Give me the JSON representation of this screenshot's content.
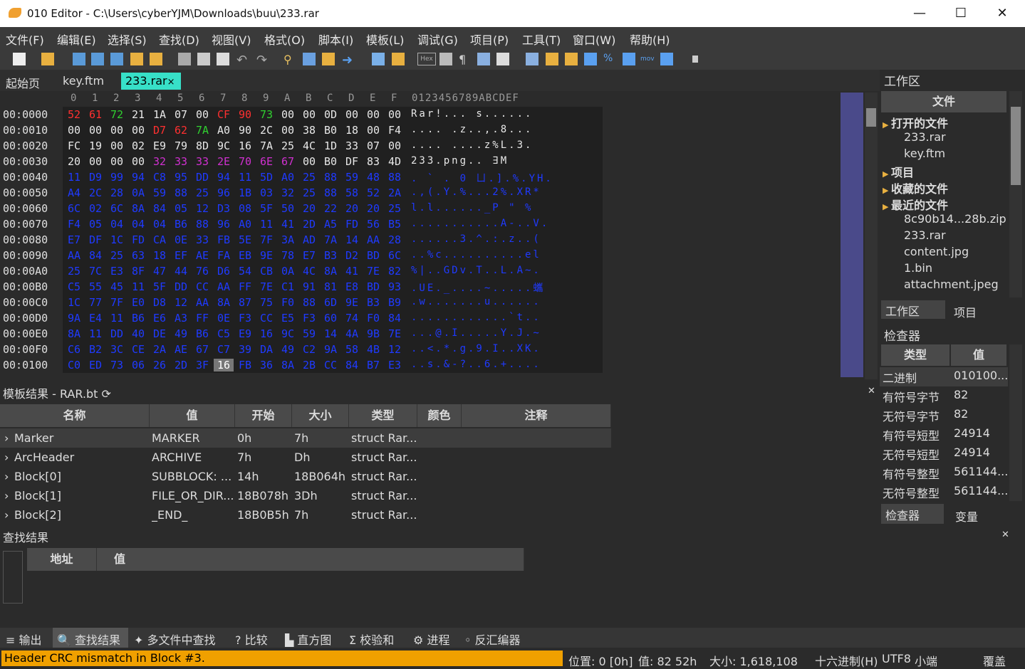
{
  "window": {
    "title": "010 Editor - C:\\Users\\cyberYJM\\Downloads\\buu\\233.rar",
    "min": "—",
    "max": "☐",
    "close": "✕"
  },
  "menu": [
    "文件(F)",
    "编辑(E)",
    "选择(S)",
    "查找(D)",
    "视图(V)",
    "格式(O)",
    "脚本(I)",
    "模板(L)",
    "调试(G)",
    "项目(P)",
    "工具(T)",
    "窗口(W)",
    "帮助(H)"
  ],
  "tabs": [
    "起始页",
    "key.ftm",
    "233.rar"
  ],
  "tab_close": "×",
  "hex": {
    "col_header": [
      "0",
      "1",
      "2",
      "3",
      "4",
      "5",
      "6",
      "7",
      "8",
      "9",
      "A",
      "B",
      "C",
      "D",
      "E",
      "F"
    ],
    "ascii_header": "0123456789ABCDEF",
    "rows": [
      {
        "addr": "00:0000",
        "bytes": [
          "52",
          "61",
          "72",
          "21",
          "1A",
          "07",
          "00",
          "CF",
          "90",
          "73",
          "00",
          "00",
          "0D",
          "00",
          "00",
          "00"
        ],
        "ascii": "Rar!...  s......"
      },
      {
        "addr": "00:0010",
        "bytes": [
          "00",
          "00",
          "00",
          "00",
          "D7",
          "62",
          "7A",
          "A0",
          "90",
          "2C",
          "00",
          "38",
          "B0",
          "18",
          "00",
          "F4"
        ],
        "ascii": "....  .z..,.8..."
      },
      {
        "addr": "00:0020",
        "bytes": [
          "FC",
          "19",
          "00",
          "02",
          "E9",
          "79",
          "8D",
          "9C",
          "16",
          "7A",
          "25",
          "4C",
          "1D",
          "33",
          "07",
          "00"
        ],
        "ascii": "....  ....z%L.3."
      },
      {
        "addr": "00:0030",
        "bytes": [
          "20",
          "00",
          "00",
          "00",
          "32",
          "33",
          "33",
          "2E",
          "70",
          "6E",
          "67",
          "00",
          "B0",
          "DF",
          "83",
          "4D"
        ],
        "ascii": "    233.png.. ∃M"
      },
      {
        "addr": "00:0040",
        "bytes": [
          "11",
          "D9",
          "99",
          "94",
          "C8",
          "95",
          "DD",
          "94",
          "11",
          "5D",
          "A0",
          "25",
          "88",
          "59",
          "48",
          "88"
        ],
        "ascii": ". ` . 0 ㄩ.].%.YH."
      },
      {
        "addr": "00:0050",
        "bytes": [
          "A4",
          "2C",
          "28",
          "0A",
          "59",
          "88",
          "25",
          "96",
          "1B",
          "03",
          "32",
          "25",
          "88",
          "58",
          "52",
          "2A"
        ],
        "ascii": ".,(.Y.%...2%.XR*"
      },
      {
        "addr": "00:0060",
        "bytes": [
          "6C",
          "02",
          "6C",
          "8A",
          "84",
          "05",
          "12",
          "D3",
          "08",
          "5F",
          "50",
          "20",
          "22",
          "20",
          "20",
          "25"
        ],
        "ascii": "l.l......_P \"  %"
      },
      {
        "addr": "00:0070",
        "bytes": [
          "F4",
          "05",
          "04",
          "04",
          "04",
          "B6",
          "88",
          "96",
          "A0",
          "11",
          "41",
          "2D",
          "A5",
          "FD",
          "56",
          "B5"
        ],
        "ascii": "...........A-..V."
      },
      {
        "addr": "00:0080",
        "bytes": [
          "E7",
          "DF",
          "1C",
          "FD",
          "CA",
          "0E",
          "33",
          "FB",
          "5E",
          "7F",
          "3A",
          "AD",
          "7A",
          "14",
          "AA",
          "28"
        ],
        "ascii": "......3.^.:.z..("
      },
      {
        "addr": "00:0090",
        "bytes": [
          "AA",
          "84",
          "25",
          "63",
          "18",
          "EF",
          "AE",
          "FA",
          "EB",
          "9E",
          "78",
          "E7",
          "B3",
          "D2",
          "BD",
          "6C"
        ],
        "ascii": "..%c..........el"
      },
      {
        "addr": "00:00A0",
        "bytes": [
          "25",
          "7C",
          "E3",
          "8F",
          "47",
          "44",
          "76",
          "D6",
          "54",
          "CB",
          "0A",
          "4C",
          "8A",
          "41",
          "7E",
          "82"
        ],
        "ascii": "%|..GDv.T..L.A~."
      },
      {
        "addr": "00:00B0",
        "bytes": [
          "C5",
          "55",
          "45",
          "11",
          "5F",
          "DD",
          "CC",
          "AA",
          "FF",
          "7E",
          "C1",
          "91",
          "81",
          "E8",
          "BD",
          "93"
        ],
        "ascii": ".UE._....~.....蠵"
      },
      {
        "addr": "00:00C0",
        "bytes": [
          "1C",
          "77",
          "7F",
          "E0",
          "D8",
          "12",
          "AA",
          "8A",
          "87",
          "75",
          "F0",
          "88",
          "6D",
          "9E",
          "B3",
          "B9"
        ],
        "ascii": ".w.......u......"
      },
      {
        "addr": "00:00D0",
        "bytes": [
          "9A",
          "E4",
          "11",
          "B6",
          "E6",
          "A3",
          "FF",
          "0E",
          "F3",
          "CC",
          "E5",
          "F3",
          "60",
          "74",
          "F0",
          "84"
        ],
        "ascii": "............`t.."
      },
      {
        "addr": "00:00E0",
        "bytes": [
          "8A",
          "11",
          "DD",
          "40",
          "DE",
          "49",
          "B6",
          "C5",
          "E9",
          "16",
          "9C",
          "59",
          "14",
          "4A",
          "9B",
          "7E"
        ],
        "ascii": "...@.I.....Y.J.~"
      },
      {
        "addr": "00:00F0",
        "bytes": [
          "C6",
          "B2",
          "3C",
          "CE",
          "2A",
          "AE",
          "67",
          "C7",
          "39",
          "DA",
          "49",
          "C2",
          "9A",
          "58",
          "4B",
          "12"
        ],
        "ascii": "..<.*.g.9.I..XK."
      },
      {
        "addr": "00:0100",
        "bytes": [
          "C0",
          "ED",
          "73",
          "06",
          "26",
          "2D",
          "3F",
          "16",
          "FB",
          "36",
          "8A",
          "2B",
          "CC",
          "84",
          "B7",
          "E3"
        ],
        "ascii": "..s.&-?..6.+...."
      }
    ]
  },
  "right": {
    "workspace_title": "工作区",
    "file_header": "文件",
    "tree": [
      {
        "label": "打开的文件",
        "bold": true
      },
      {
        "label": "233.rar",
        "bold": false
      },
      {
        "label": "key.ftm",
        "bold": false
      },
      {
        "label": "项目",
        "bold": true
      },
      {
        "label": "收藏的文件",
        "bold": true
      },
      {
        "label": "最近的文件",
        "bold": true
      },
      {
        "label": "8c90b14...28b.zip",
        "bold": false
      },
      {
        "label": "233.rar",
        "bold": false
      },
      {
        "label": "content.jpg",
        "bold": false
      },
      {
        "label": "1.bin",
        "bold": false
      },
      {
        "label": "attachment.jpeg",
        "bold": false
      }
    ],
    "pane_tabs": [
      "工作区",
      "项目"
    ],
    "inspector_title": "检查器",
    "insp_headers": [
      "类型",
      "值"
    ],
    "inspector": [
      {
        "type": "二进制",
        "value": "010100..."
      },
      {
        "type": "有符号字节",
        "value": "82"
      },
      {
        "type": "无符号字节",
        "value": "82"
      },
      {
        "type": "有符号短型",
        "value": "24914"
      },
      {
        "type": "无符号短型",
        "value": "24914"
      },
      {
        "type": "有符号整型",
        "value": "561144..."
      },
      {
        "type": "无符号整型",
        "value": "561144..."
      }
    ],
    "insp_tabs": [
      "检查器",
      "变量"
    ]
  },
  "template": {
    "title": "模板结果 - RAR.bt ⟳",
    "headers": [
      "名称",
      "值",
      "开始",
      "大小",
      "类型",
      "颜色",
      "注释"
    ],
    "rows": [
      {
        "name": "Marker",
        "value": "MARKER",
        "start": "0h",
        "size": "7h",
        "type": "struct Rar..."
      },
      {
        "name": "ArcHeader",
        "value": "ARCHIVE",
        "start": "7h",
        "size": "Dh",
        "type": "struct Rar..."
      },
      {
        "name": "Block[0]",
        "value": "SUBBLOCK: ...",
        "start": "14h",
        "size": "18B064h",
        "type": "struct Rar..."
      },
      {
        "name": "Block[1]",
        "value": "FILE_OR_DIR...",
        "start": "18B078h",
        "size": "3Dh",
        "type": "struct Rar..."
      },
      {
        "name": "Block[2]",
        "value": "_END_",
        "start": "18B0B5h",
        "size": "7h",
        "type": "struct Rar..."
      }
    ]
  },
  "find": {
    "title": "查找结果",
    "headers": [
      "地址",
      "值"
    ]
  },
  "bottom_tabs": [
    "输出",
    "查找结果",
    "多文件中查找",
    "比较",
    "直方图",
    "校验和",
    "进程",
    "反汇编器"
  ],
  "status": {
    "message": "Header CRC mismatch in Block #3.",
    "position": "位置: 0 [0h]",
    "value": "值: 82 52h",
    "size": "大小: 1,618,108",
    "mode": "十六进制(H)",
    "encoding": "UTF8",
    "endian": "小端",
    "ovr": "覆盖"
  },
  "colors": {
    "accent_tab": "#37e0c8",
    "status_warn": "#f0a000",
    "hex_blue": "#1f3aff",
    "hex_red": "#ff3030",
    "hex_green": "#30d030",
    "hex_magenta": "#d030d0"
  }
}
